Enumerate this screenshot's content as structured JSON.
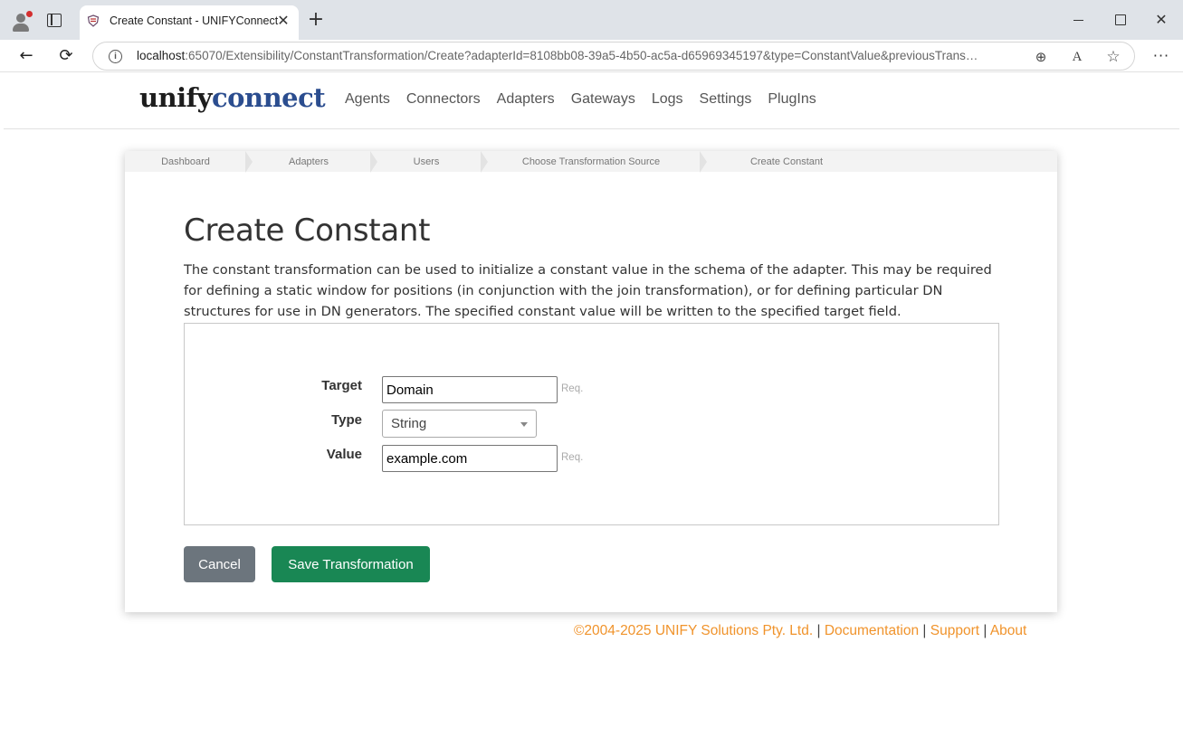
{
  "browser": {
    "tab_title": "Create Constant - UNIFYConnect",
    "tab_close": "✕",
    "new_tab": "+",
    "url_host": "localhost",
    "url_rest": ":65070/Extensibility/ConstantTransformation/Create?adapterId=8108bb08-39a5-4b50-ac5a-d65969345197&type=ConstantValue&previousTransfo...",
    "info_glyph": "i",
    "icons": [
      "profile-icon",
      "tab-actions-icon",
      "favicon",
      "back-icon",
      "reload-icon",
      "info-icon",
      "zoom-icon",
      "read-aloud-icon",
      "favorites-icon",
      "menu-icon",
      "minimize-icon",
      "maximize-icon",
      "close-icon"
    ],
    "glyphs": {
      "back": "←",
      "reload": "⟳",
      "zoom": "⊕",
      "read": "A",
      "fav": "☆",
      "menu": "···",
      "close": "✕"
    }
  },
  "site": {
    "logo_unify": "unify",
    "logo_connect": "connect",
    "nav": [
      "Agents",
      "Connectors",
      "Adapters",
      "Gateways",
      "Logs",
      "Settings",
      "PlugIns"
    ]
  },
  "breadcrumb": [
    "Dashboard",
    "Adapters",
    "Users",
    "Choose Transformation Source",
    "Create Constant"
  ],
  "main": {
    "title": "Create Constant",
    "description": "The constant transformation can be used to initialize a constant value in the schema of the adapter. This may be required for defining a static window for positions (in conjunction with the join transformation), or for defining particular DN structures for use in DN generators. The specified constant value will be written to the specified target field.",
    "form": {
      "target_label": "Target",
      "target_value": "Domain",
      "target_req": "Req.",
      "type_label": "Type",
      "type_value": "String",
      "value_label": "Value",
      "value_value": "example.com",
      "value_req": "Req."
    },
    "cancel_label": "Cancel",
    "save_label": "Save Transformation"
  },
  "footer": {
    "copyright": "©2004-2025 UNIFY Solutions Pty. Ltd.",
    "sep": "|",
    "documentation": "Documentation",
    "support": "Support",
    "about": "About"
  },
  "colors": {
    "accent_orange": "#f0932b",
    "logo_blue": "#2b4d8f",
    "save_green": "#198754",
    "cancel_gray": "#6c757d"
  }
}
